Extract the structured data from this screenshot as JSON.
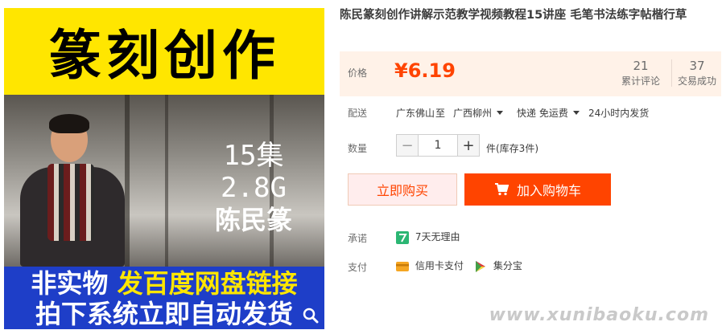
{
  "hero": {
    "title": "篆刻创作",
    "info": [
      "15集",
      "2.8G",
      "陈民篆"
    ],
    "banner_line1_a": "非实物",
    "banner_line1_b": "发百度网盘链接",
    "banner_line2": "拍下系统立即自动发货"
  },
  "product": {
    "title": "陈民篆刻创作讲解示范教学视频教程15讲座 毛笔书法练字帖楷行草"
  },
  "price": {
    "label": "价格",
    "value": "¥6.19",
    "reviews_count": "21",
    "reviews_label": "累计评论",
    "sales_count": "37",
    "sales_label": "交易成功"
  },
  "shipping": {
    "label": "配送",
    "from": "广东佛山",
    "to_word": "至",
    "to": "广西柳州",
    "method": "快递 免运费",
    "time": "24小时内发货"
  },
  "quantity": {
    "label": "数量",
    "value": "1",
    "minus": "−",
    "plus": "+",
    "stock": "件(库存3件)"
  },
  "actions": {
    "buy_now": "立即购买",
    "add_cart": "加入购物车"
  },
  "promise": {
    "label": "承诺",
    "text": "7天无理由"
  },
  "payment": {
    "label": "支付",
    "credit": "信用卡支付",
    "jifen": "集分宝"
  },
  "watermark": "www.xunibaoku.com",
  "colors": {
    "accent": "#ff4400",
    "price_bg": "#fff2e8",
    "hero_yellow": "#ffe600",
    "hero_blue": "#1e3ec8"
  }
}
